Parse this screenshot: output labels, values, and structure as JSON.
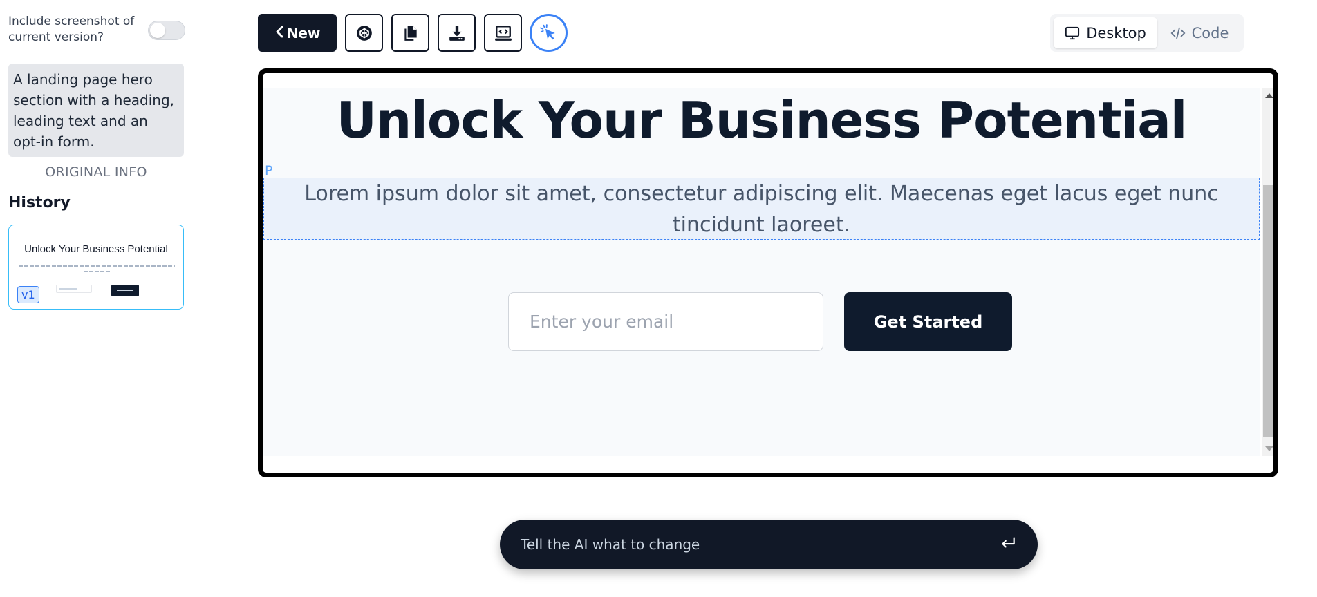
{
  "sidebar": {
    "toggle_label": "Include screenshot of current version?",
    "prompt": "A landing page hero section with a heading, leading text and an opt-in form.",
    "original_info": "ORIGINAL INFO",
    "history_title": "History",
    "history": [
      {
        "version": "v1",
        "thumb_title": "Unlock Your Business Potential"
      }
    ]
  },
  "toolbar": {
    "new_label": "New",
    "icons": [
      "codepen-icon",
      "copy-icon",
      "download-icon",
      "code-window-icon",
      "select-cursor-icon"
    ]
  },
  "view_toggle": {
    "desktop_label": "Desktop",
    "code_label": "Code"
  },
  "preview": {
    "heading": "Unlock Your Business Potential",
    "element_tag": "P",
    "lead_text": "Lorem ipsum dolor sit amet, consectetur adipiscing elit. Maecenas eget lacus eget nunc tincidunt laoreet.",
    "email_placeholder": "Enter your email",
    "cta_label": "Get Started"
  },
  "chat": {
    "placeholder": "Tell the AI what to change"
  },
  "colors": {
    "accent": "#3b82f6",
    "dark": "#0f1b2d",
    "toolbar_dark": "#111827"
  }
}
